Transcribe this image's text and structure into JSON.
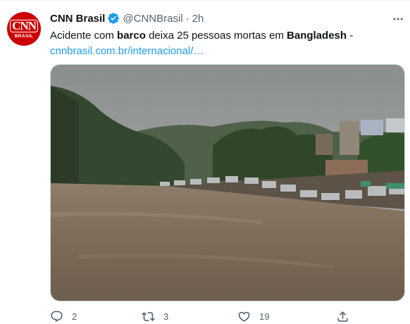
{
  "tweet": {
    "display_name": "CNN Brasil",
    "handle": "@CNNBrasil",
    "separator": "·",
    "time": "2h",
    "text_parts": [
      {
        "text": "Acidente com ",
        "bold": false
      },
      {
        "text": "barco",
        "bold": true
      },
      {
        "text": " deixa 25 pessoas mortas em ",
        "bold": false
      },
      {
        "text": "Bangladesh",
        "bold": true
      },
      {
        "text": " -",
        "bold": false
      }
    ],
    "link": "cnnbrasil.com.br/internacional/…"
  },
  "avatar": {
    "logo_main": "CNN",
    "logo_sub": "BRASIL",
    "color": "#cc0000"
  },
  "actions": {
    "reply_count": "2",
    "retweet_count": "3",
    "like_count": "19"
  },
  "colors": {
    "accent": "#1d9bf0",
    "muted": "#536471",
    "verified": "#1d9bf0"
  }
}
